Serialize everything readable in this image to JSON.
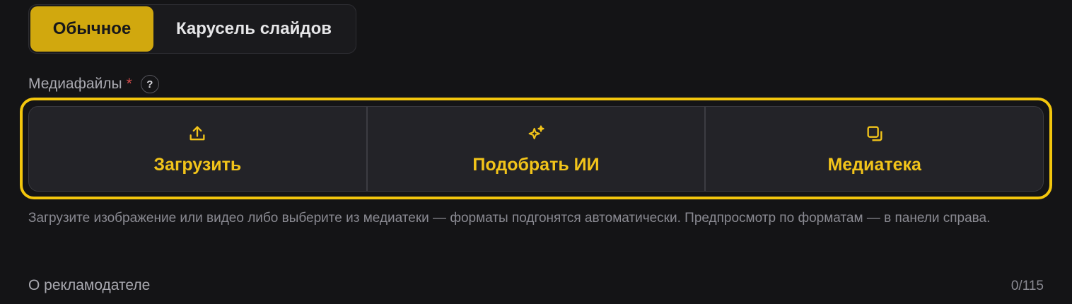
{
  "tabs": [
    {
      "label": "Обычное",
      "active": true
    },
    {
      "label": "Карусель слайдов",
      "active": false
    }
  ],
  "media": {
    "label": "Медиафайлы",
    "required_mark": "*",
    "help": "?",
    "options": [
      {
        "label": "Загрузить",
        "icon": "upload-icon"
      },
      {
        "label": "Подобрать ИИ",
        "icon": "sparkles-icon"
      },
      {
        "label": "Медиатека",
        "icon": "media-library-icon"
      }
    ],
    "hint": "Загрузите изображение или видео либо выберите из медиатеки — форматы подгонятся автоматически. Предпросмотр по форматам — в панели справа."
  },
  "advertiser": {
    "label": "О рекламодателе",
    "counter": "0/115"
  },
  "colors": {
    "accent": "#f2c41a",
    "active_tab": "#d1a80e",
    "highlight": "#f3c60d",
    "background": "#141416"
  }
}
